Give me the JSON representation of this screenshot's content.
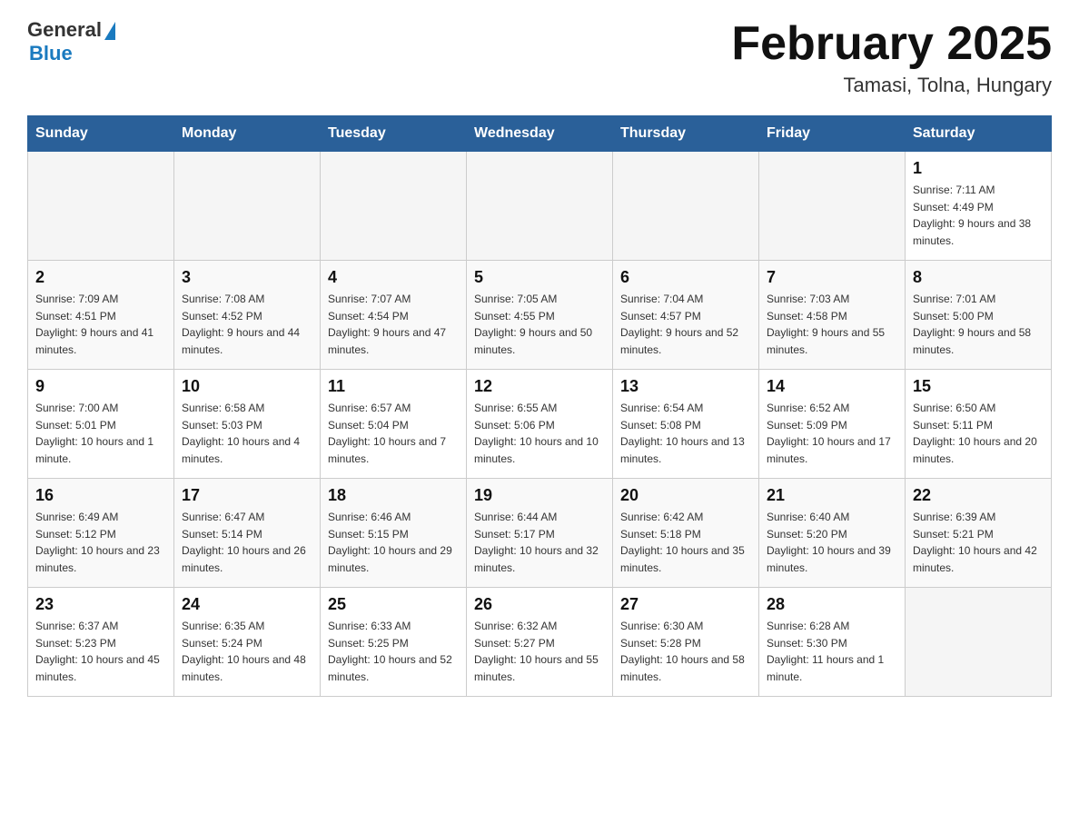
{
  "header": {
    "logo_general": "General",
    "logo_blue": "Blue",
    "title": "February 2025",
    "location": "Tamasi, Tolna, Hungary"
  },
  "days_of_week": [
    "Sunday",
    "Monday",
    "Tuesday",
    "Wednesday",
    "Thursday",
    "Friday",
    "Saturday"
  ],
  "weeks": [
    [
      {
        "day": "",
        "info": ""
      },
      {
        "day": "",
        "info": ""
      },
      {
        "day": "",
        "info": ""
      },
      {
        "day": "",
        "info": ""
      },
      {
        "day": "",
        "info": ""
      },
      {
        "day": "",
        "info": ""
      },
      {
        "day": "1",
        "info": "Sunrise: 7:11 AM\nSunset: 4:49 PM\nDaylight: 9 hours and 38 minutes."
      }
    ],
    [
      {
        "day": "2",
        "info": "Sunrise: 7:09 AM\nSunset: 4:51 PM\nDaylight: 9 hours and 41 minutes."
      },
      {
        "day": "3",
        "info": "Sunrise: 7:08 AM\nSunset: 4:52 PM\nDaylight: 9 hours and 44 minutes."
      },
      {
        "day": "4",
        "info": "Sunrise: 7:07 AM\nSunset: 4:54 PM\nDaylight: 9 hours and 47 minutes."
      },
      {
        "day": "5",
        "info": "Sunrise: 7:05 AM\nSunset: 4:55 PM\nDaylight: 9 hours and 50 minutes."
      },
      {
        "day": "6",
        "info": "Sunrise: 7:04 AM\nSunset: 4:57 PM\nDaylight: 9 hours and 52 minutes."
      },
      {
        "day": "7",
        "info": "Sunrise: 7:03 AM\nSunset: 4:58 PM\nDaylight: 9 hours and 55 minutes."
      },
      {
        "day": "8",
        "info": "Sunrise: 7:01 AM\nSunset: 5:00 PM\nDaylight: 9 hours and 58 minutes."
      }
    ],
    [
      {
        "day": "9",
        "info": "Sunrise: 7:00 AM\nSunset: 5:01 PM\nDaylight: 10 hours and 1 minute."
      },
      {
        "day": "10",
        "info": "Sunrise: 6:58 AM\nSunset: 5:03 PM\nDaylight: 10 hours and 4 minutes."
      },
      {
        "day": "11",
        "info": "Sunrise: 6:57 AM\nSunset: 5:04 PM\nDaylight: 10 hours and 7 minutes."
      },
      {
        "day": "12",
        "info": "Sunrise: 6:55 AM\nSunset: 5:06 PM\nDaylight: 10 hours and 10 minutes."
      },
      {
        "day": "13",
        "info": "Sunrise: 6:54 AM\nSunset: 5:08 PM\nDaylight: 10 hours and 13 minutes."
      },
      {
        "day": "14",
        "info": "Sunrise: 6:52 AM\nSunset: 5:09 PM\nDaylight: 10 hours and 17 minutes."
      },
      {
        "day": "15",
        "info": "Sunrise: 6:50 AM\nSunset: 5:11 PM\nDaylight: 10 hours and 20 minutes."
      }
    ],
    [
      {
        "day": "16",
        "info": "Sunrise: 6:49 AM\nSunset: 5:12 PM\nDaylight: 10 hours and 23 minutes."
      },
      {
        "day": "17",
        "info": "Sunrise: 6:47 AM\nSunset: 5:14 PM\nDaylight: 10 hours and 26 minutes."
      },
      {
        "day": "18",
        "info": "Sunrise: 6:46 AM\nSunset: 5:15 PM\nDaylight: 10 hours and 29 minutes."
      },
      {
        "day": "19",
        "info": "Sunrise: 6:44 AM\nSunset: 5:17 PM\nDaylight: 10 hours and 32 minutes."
      },
      {
        "day": "20",
        "info": "Sunrise: 6:42 AM\nSunset: 5:18 PM\nDaylight: 10 hours and 35 minutes."
      },
      {
        "day": "21",
        "info": "Sunrise: 6:40 AM\nSunset: 5:20 PM\nDaylight: 10 hours and 39 minutes."
      },
      {
        "day": "22",
        "info": "Sunrise: 6:39 AM\nSunset: 5:21 PM\nDaylight: 10 hours and 42 minutes."
      }
    ],
    [
      {
        "day": "23",
        "info": "Sunrise: 6:37 AM\nSunset: 5:23 PM\nDaylight: 10 hours and 45 minutes."
      },
      {
        "day": "24",
        "info": "Sunrise: 6:35 AM\nSunset: 5:24 PM\nDaylight: 10 hours and 48 minutes."
      },
      {
        "day": "25",
        "info": "Sunrise: 6:33 AM\nSunset: 5:25 PM\nDaylight: 10 hours and 52 minutes."
      },
      {
        "day": "26",
        "info": "Sunrise: 6:32 AM\nSunset: 5:27 PM\nDaylight: 10 hours and 55 minutes."
      },
      {
        "day": "27",
        "info": "Sunrise: 6:30 AM\nSunset: 5:28 PM\nDaylight: 10 hours and 58 minutes."
      },
      {
        "day": "28",
        "info": "Sunrise: 6:28 AM\nSunset: 5:30 PM\nDaylight: 11 hours and 1 minute."
      },
      {
        "day": "",
        "info": ""
      }
    ]
  ]
}
